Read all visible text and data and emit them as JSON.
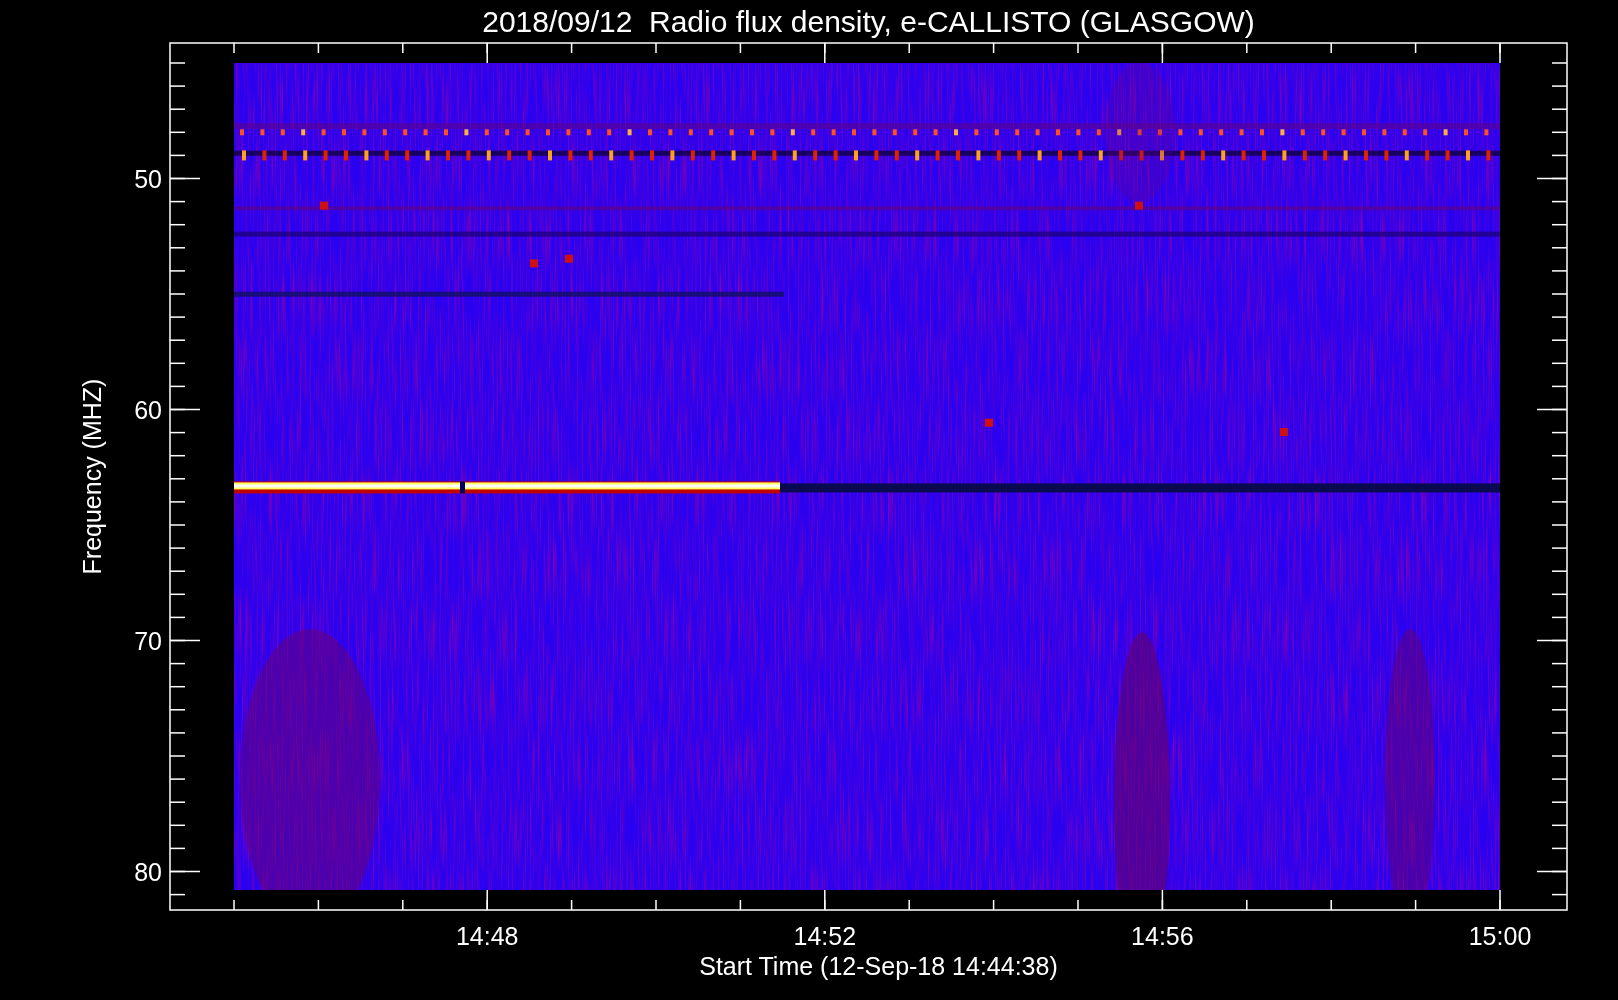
{
  "plot": {
    "title": "2018/09/12  Radio flux density, e-CALLISTO (GLASGOW)",
    "y_axis": {
      "label": "Frequency (MHZ)",
      "ticks": [
        "50",
        "60",
        "70",
        "80"
      ]
    },
    "x_axis": {
      "label": "Start Time (12-Sep-18 14:44:38)",
      "ticks": [
        "14:48",
        "14:52",
        "14:56",
        "15:00"
      ]
    }
  }
}
